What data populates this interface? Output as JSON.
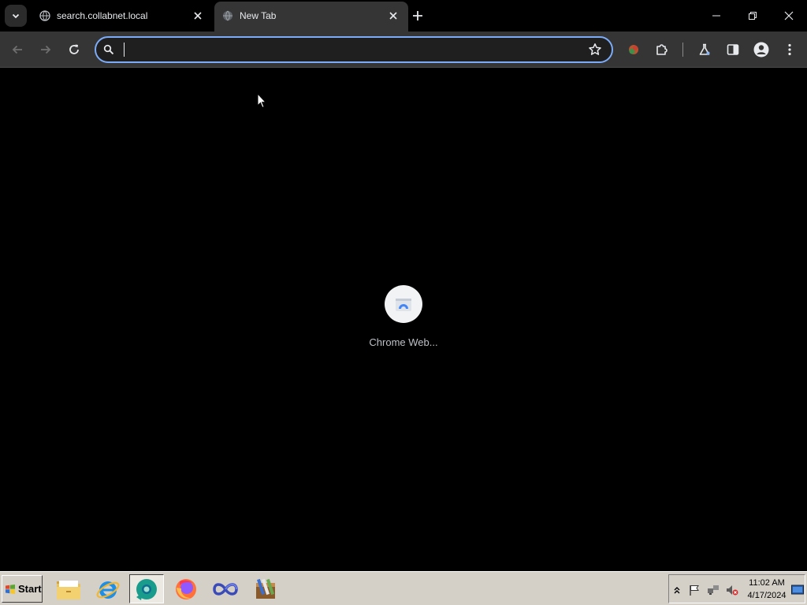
{
  "browser": {
    "tabs": [
      {
        "title": "search.collabnet.local",
        "active": false,
        "favicon": "globe-icon"
      },
      {
        "title": "New Tab",
        "active": true,
        "favicon": "globe-icon"
      }
    ],
    "omnibox": {
      "value": "",
      "placeholder": ""
    },
    "accent_color": "#7cacf8",
    "toolbar_icons": [
      "back-icon",
      "forward-icon",
      "reload-icon",
      "search-icon",
      "star-icon",
      "extension-color-icon",
      "puzzle-icon",
      "flask-icon",
      "side-panel-icon",
      "profile-icon",
      "menu-icon"
    ]
  },
  "newtab": {
    "shortcuts": [
      {
        "label": "Chrome Web...",
        "icon": "chrome-web-store-icon"
      }
    ]
  },
  "taskbar": {
    "start_label": "Start",
    "apps": [
      "file-explorer-icon",
      "internet-explorer-icon",
      "chrome-icon",
      "firefox-icon",
      "infinity-app-icon",
      "archive-app-icon"
    ],
    "tray_icons": [
      "show-hidden-icon",
      "action-center-flag-icon",
      "network-icon",
      "volume-muted-icon"
    ],
    "clock": {
      "time": "11:02 AM",
      "date": "4/17/2024"
    }
  }
}
